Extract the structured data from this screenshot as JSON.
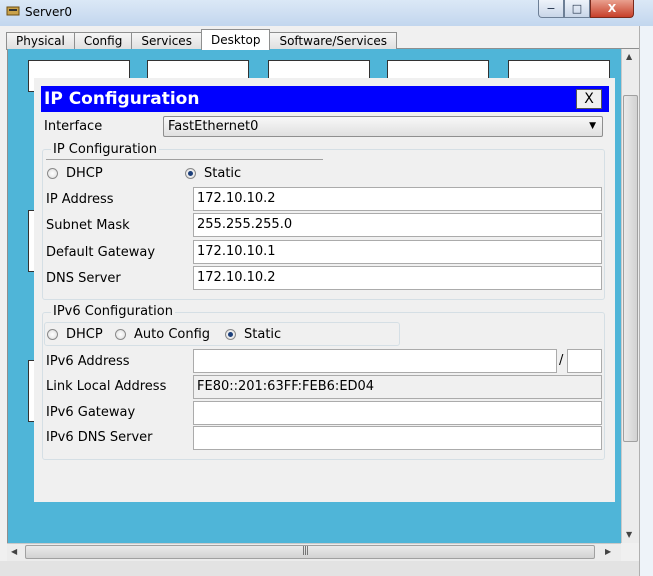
{
  "window": {
    "title": "Server0",
    "minimize": "−",
    "maximize": "□",
    "close": "X"
  },
  "tabs": [
    "Physical",
    "Config",
    "Services",
    "Desktop",
    "Software/Services"
  ],
  "active_tab": "Desktop",
  "scroll_grip": "|||",
  "dialog": {
    "title": "IP Configuration",
    "close": "X",
    "interface_label": "Interface",
    "interface_value": "FastEthernet0",
    "ipv4": {
      "caption": "IP Configuration",
      "mode_options": [
        "DHCP",
        "Static"
      ],
      "selected_mode": "Static",
      "ip_address_label": "IP Address",
      "ip_address": "172.10.10.2",
      "subnet_mask_label": "Subnet Mask",
      "subnet_mask": "255.255.255.0",
      "gateway_label": "Default Gateway",
      "gateway": "172.10.10.1",
      "dns_label": "DNS Server",
      "dns": "172.10.10.2"
    },
    "ipv6": {
      "caption": "IPv6 Configuration",
      "mode_options": [
        "DHCP",
        "Auto Config",
        "Static"
      ],
      "selected_mode": "Static",
      "address_label": "IPv6 Address",
      "address": "",
      "prefix_separator": "/",
      "prefix": "",
      "link_local_label": "Link Local Address",
      "link_local": "FE80::201:63FF:FEB6:ED04",
      "gateway_label": "IPv6 Gateway",
      "gateway": "",
      "dns_label": "IPv6 DNS Server",
      "dns": ""
    }
  },
  "colors": {
    "desktop_bg": "#4fb5d8",
    "dialog_title_bg": "#0000ff",
    "dialog_title_fg": "#ffffff"
  }
}
